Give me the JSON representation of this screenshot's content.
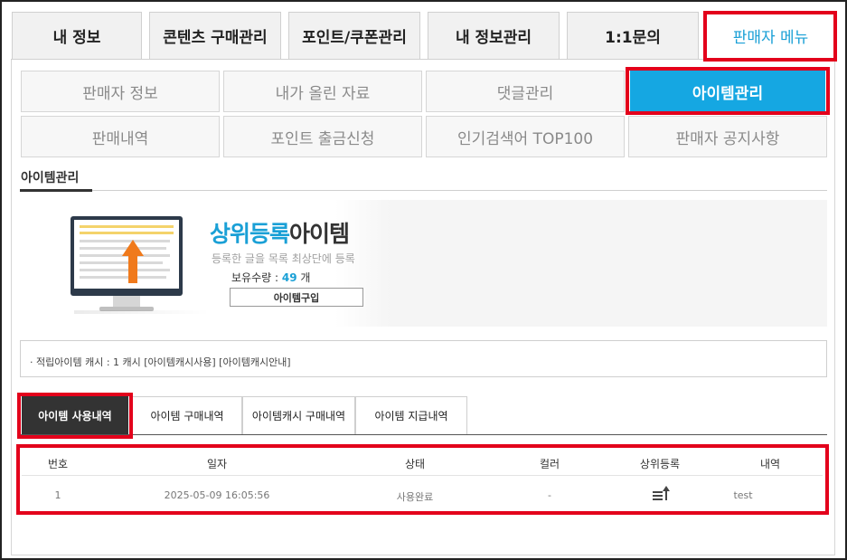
{
  "top_tabs": [
    {
      "label": "내 정보"
    },
    {
      "label": "콘텐츠 구매관리"
    },
    {
      "label": "포인트/쿠폰관리"
    },
    {
      "label": "내 정보관리"
    },
    {
      "label": "1:1문의"
    },
    {
      "label": "판매자 메뉴",
      "active": true
    }
  ],
  "seller_menu": [
    {
      "label": "판매자 정보"
    },
    {
      "label": "내가 올린 자료"
    },
    {
      "label": "댓글관리"
    },
    {
      "label": "아이템관리",
      "active": true
    },
    {
      "label": "판매내역"
    },
    {
      "label": "포인트 출금신청"
    },
    {
      "label": "인기검색어 TOP100"
    },
    {
      "label": "판매자 공지사항"
    }
  ],
  "section_title": "아이템관리",
  "banner": {
    "title_highlight": "상위등록",
    "title_rest": "아이템",
    "description": "등록한 글을 목록 최상단에 등록",
    "quantity_label": "보유수량 : ",
    "quantity_value": "49",
    "quantity_unit": " 개",
    "buy_button": "아이템구입"
  },
  "cache_info": "· 적립아이템 캐시 : 1 캐시 [아이템캐시사용] [아이템캐시안내]",
  "bottom_tabs": [
    {
      "label": "아이템 사용내역",
      "active": true
    },
    {
      "label": "아이템 구매내역"
    },
    {
      "label": "아이템캐시 구매내역"
    },
    {
      "label": "아이템 지급내역"
    }
  ],
  "table": {
    "headers": [
      "번호",
      "일자",
      "상태",
      "컬러",
      "상위등록",
      "내역"
    ],
    "rows": [
      {
        "no": "1",
        "date": "2025-05-09 16:05:56",
        "status": "사용완료",
        "color": "-",
        "top_icon": "list-up-icon",
        "detail": "test"
      }
    ]
  },
  "colors": {
    "accent": "#1aa0d6",
    "highlight_border": "#e3001b",
    "active_tab_dark": "#333333",
    "arrow_orange": "#f07a1c"
  }
}
